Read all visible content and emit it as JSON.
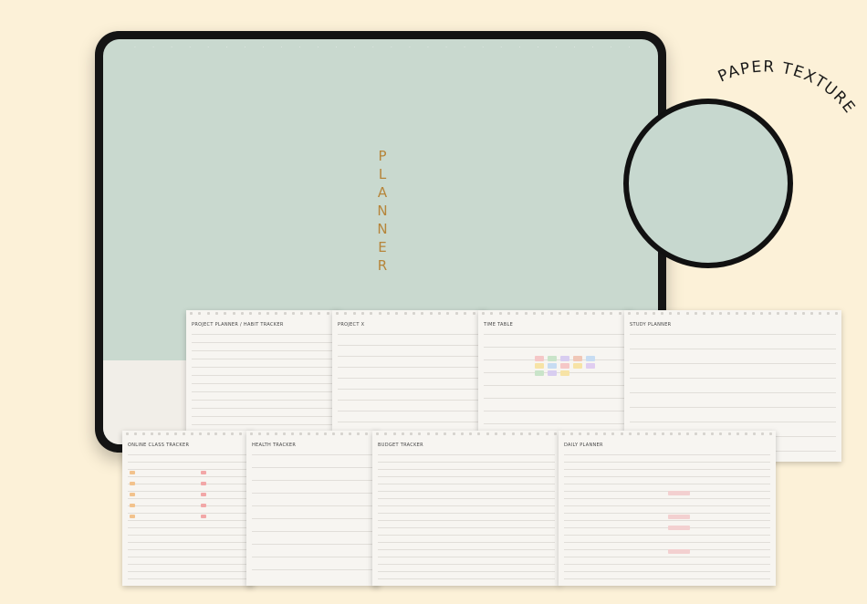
{
  "cover": {
    "title_letters": [
      "P",
      "L",
      "A",
      "N",
      "N",
      "E",
      "R"
    ],
    "accent_color": "#b6853a",
    "screen_color": "#c9d9cf"
  },
  "texture_badge": {
    "label": "PAPER TEXTURE"
  },
  "pages": [
    {
      "title": "PROJECT PLANNER / HABIT TRACKER"
    },
    {
      "title": "PROJECT X"
    },
    {
      "title": "TIME TABLE"
    },
    {
      "title": "STUDY PLANNER"
    },
    {
      "title": "ONLINE CLASS TRACKER"
    },
    {
      "title": "HEALTH TRACKER"
    },
    {
      "title": "BUDGET TRACKER"
    },
    {
      "title": "DAILY PLANNER"
    }
  ]
}
